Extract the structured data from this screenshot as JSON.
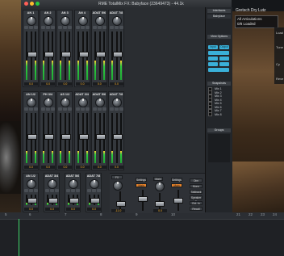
{
  "window": {
    "title": "RME TotalMix FX: Babyface (23649473) - 44.1k",
    "traffic_lights": [
      "#ff5f57",
      "#febc2e",
      "#28c840"
    ]
  },
  "mixer": {
    "input_row": {
      "channels": [
        {
          "name": "AN 1",
          "value": "0.0"
        },
        {
          "name": "AN 2",
          "value": "0.0"
        },
        {
          "name": "AN 3",
          "value": "0.0"
        },
        {
          "name": "AN 4",
          "value": "0.0"
        },
        {
          "name": "ADAT 5/6",
          "value": "0.0"
        },
        {
          "name": "ADAT 7/8",
          "value": "0.0"
        }
      ]
    },
    "playback_row": {
      "channels": [
        {
          "name": "AN 1/2",
          "value": "0.0"
        },
        {
          "name": "PH 3/4",
          "value": "0.0"
        },
        {
          "name": "AS 1/2",
          "value": "0.0"
        },
        {
          "name": "ADAT 3/4",
          "value": "0.0"
        },
        {
          "name": "ADAT 5/6",
          "value": "0.0"
        },
        {
          "name": "ADAT 7/8",
          "value": "0.0"
        }
      ]
    },
    "output_row": {
      "channels": [
        {
          "name": "AN 1/2",
          "value": "0.0"
        },
        {
          "name": "ADAT 3/4",
          "value": "0.0"
        },
        {
          "name": "ADAT 5/6",
          "value": "0.0"
        },
        {
          "name": "ADAT 7/8",
          "value": "0.0"
        }
      ]
    },
    "output_section": {
      "main_label": "Main",
      "settings_label": "Settings",
      "settings_label_2": "Settings",
      "fx_label": "FX",
      "value_left": "-11.0",
      "value_right": "0.0",
      "buttons": [
        "Dim",
        "Mono",
        "Talkback",
        "Speaker B",
        "Ext. In",
        "Recall"
      ],
      "small_buttons": [
        "Mute",
        "Solo",
        "FX"
      ]
    }
  },
  "right_panel": {
    "header": "Interfaces",
    "device": "Babyface",
    "view_options": "View Options",
    "mode_buttons": [
      "Input",
      "Output"
    ],
    "snapshots_header": "Snapshots",
    "snapshot_list": [
      "Mix 1",
      "Mix 2",
      "Mix 3",
      "Mix 4",
      "Mix 5",
      "Mix 6",
      "Mix 7",
      "Mix 8"
    ],
    "groups_header": "Groups",
    "accent": "#3ab0d8"
  },
  "plugin": {
    "title": "Gretsch Dry Lutz",
    "articulation": "All Articulations",
    "loaded": "0/8 Loaded",
    "side_items": [
      "Load",
      "Tune",
      "Cy",
      "Reve"
    ]
  },
  "daw": {
    "ruler_marks": [
      "5",
      "6",
      "7",
      "8",
      "9",
      "10",
      "21",
      "22",
      "23",
      "24"
    ]
  }
}
